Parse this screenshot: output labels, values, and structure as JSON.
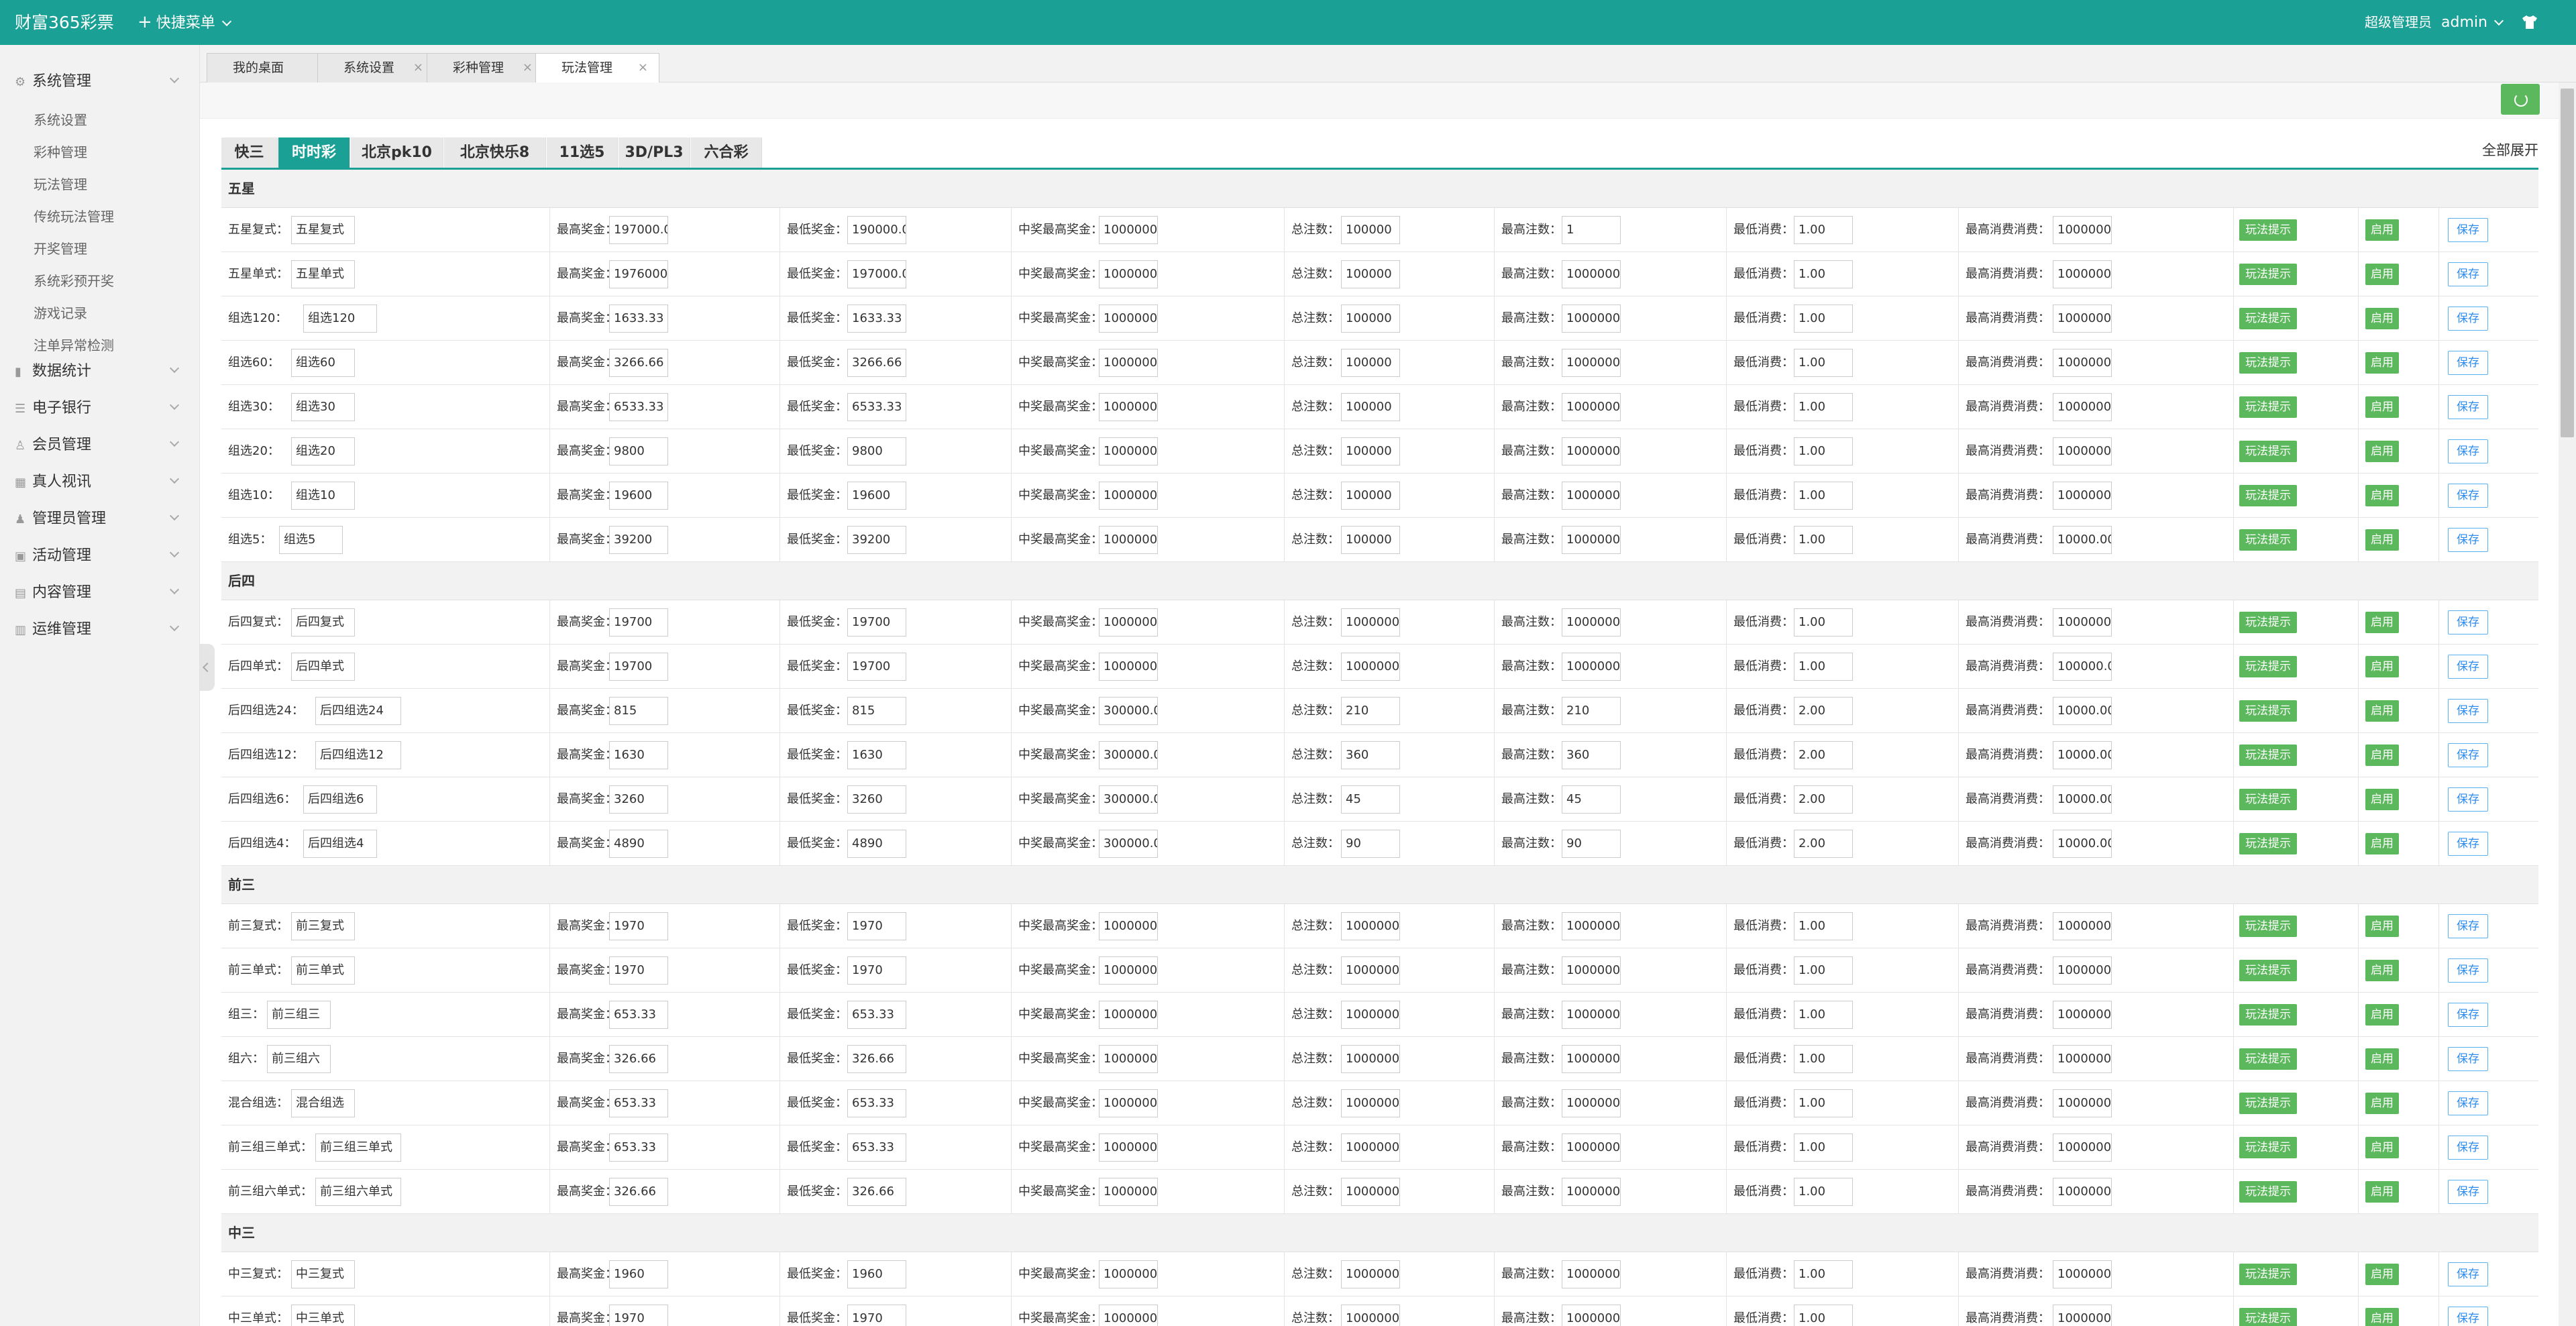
{
  "header": {
    "brand": "财富365彩票",
    "quick_menu": "快捷菜单",
    "role": "超级管理员",
    "user": "admin"
  },
  "sidebar": {
    "groups": [
      {
        "label": "系统管理",
        "icon": "gear-icon",
        "expanded": true,
        "items": [
          "系统设置",
          "彩种管理",
          "玩法管理",
          "传统玩法管理",
          "开奖管理",
          "系统彩预开奖",
          "游戏记录",
          "注单异常检测"
        ]
      },
      {
        "label": "数据统计",
        "icon": "chart-icon"
      },
      {
        "label": "电子银行",
        "icon": "list-icon"
      },
      {
        "label": "会员管理",
        "icon": "user-icon"
      },
      {
        "label": "真人视讯",
        "icon": "video-icon"
      },
      {
        "label": "管理员管理",
        "icon": "admin-icon"
      },
      {
        "label": "活动管理",
        "icon": "activity-icon"
      },
      {
        "label": "内容管理",
        "icon": "content-icon"
      },
      {
        "label": "运维管理",
        "icon": "ops-icon"
      }
    ]
  },
  "page_tabs": [
    "我的桌面",
    "系统设置",
    "彩种管理",
    "玩法管理"
  ],
  "active_page_tab": "玩法管理",
  "game_tabs": [
    "快三",
    "时时彩",
    "北京pk10",
    "北京快乐8",
    "11选5",
    "3D/PL3",
    "六合彩"
  ],
  "active_game_tab": "时时彩",
  "expand_all": "全部展开",
  "field_labels": {
    "max_prize": "最高奖金：",
    "min_prize": "最低奖金：",
    "win_max_prize": "中奖最高奖金：",
    "total_bets": "总注数：",
    "max_bets": "最高注数：",
    "min_cost": "最低消费：",
    "max_cost": "最高消费消费："
  },
  "buttons": {
    "tip": "玩法提示",
    "enable": "启用",
    "save": "保存"
  },
  "sections": [
    {
      "title": "五星",
      "rows": [
        {
          "label": "五星复式：",
          "name": "五星复式",
          "max_prize": "197000.0",
          "min_prize": "190000.0",
          "win_max": "1000000.",
          "total": "100000",
          "max_bets": "1",
          "min_cost": "1.00",
          "max_cost": "1000000."
        },
        {
          "label": "五星单式：",
          "name": "五星单式",
          "max_prize": "1976000",
          "min_prize": "197000.0",
          "win_max": "1000000.",
          "total": "100000",
          "max_bets": "1000000(",
          "min_cost": "1.00",
          "max_cost": "1000000."
        },
        {
          "label": "组选120：",
          "name": "组选120",
          "max_prize": "1633.33",
          "min_prize": "1633.33",
          "win_max": "1000000.",
          "total": "100000",
          "max_bets": "1000000",
          "min_cost": "1.00",
          "max_cost": "1000000."
        },
        {
          "label": "组选60：",
          "name": "组选60",
          "max_prize": "3266.66",
          "min_prize": "3266.66",
          "win_max": "1000000.",
          "total": "100000",
          "max_bets": "1000000",
          "min_cost": "1.00",
          "max_cost": "1000000."
        },
        {
          "label": "组选30：",
          "name": "组选30",
          "max_prize": "6533.33",
          "min_prize": "6533.33",
          "win_max": "1000000.",
          "total": "100000",
          "max_bets": "1000000",
          "min_cost": "1.00",
          "max_cost": "1000000."
        },
        {
          "label": "组选20：",
          "name": "组选20",
          "max_prize": "9800",
          "min_prize": "9800",
          "win_max": "1000000.",
          "total": "100000",
          "max_bets": "1000000",
          "min_cost": "1.00",
          "max_cost": "1000000."
        },
        {
          "label": "组选10：",
          "name": "组选10",
          "max_prize": "19600",
          "min_prize": "19600",
          "win_max": "1000000.",
          "total": "100000",
          "max_bets": "1000000",
          "min_cost": "1.00",
          "max_cost": "1000000."
        },
        {
          "label": "组选5：",
          "name": "组选5",
          "max_prize": "39200",
          "min_prize": "39200",
          "win_max": "1000000.",
          "total": "100000",
          "max_bets": "1000000",
          "min_cost": "1.00",
          "max_cost": "10000.00"
        }
      ]
    },
    {
      "title": "后四",
      "rows": [
        {
          "label": "后四复式：",
          "name": "后四复式",
          "max_prize": "19700",
          "min_prize": "19700",
          "win_max": "1000000.",
          "total": "1000000",
          "max_bets": "1000000",
          "min_cost": "1.00",
          "max_cost": "1000000."
        },
        {
          "label": "后四单式：",
          "name": "后四单式",
          "max_prize": "19700",
          "min_prize": "19700",
          "win_max": "1000000.",
          "total": "1000000",
          "max_bets": "1000000",
          "min_cost": "1.00",
          "max_cost": "100000.0"
        },
        {
          "label": "后四组选24：",
          "name": "后四组选24",
          "max_prize": "815",
          "min_prize": "815",
          "win_max": "300000.0",
          "total": "210",
          "max_bets": "210",
          "min_cost": "2.00",
          "max_cost": "10000.00"
        },
        {
          "label": "后四组选12：",
          "name": "后四组选12",
          "max_prize": "1630",
          "min_prize": "1630",
          "win_max": "300000.0",
          "total": "360",
          "max_bets": "360",
          "min_cost": "2.00",
          "max_cost": "10000.00"
        },
        {
          "label": "后四组选6：",
          "name": "后四组选6",
          "max_prize": "3260",
          "min_prize": "3260",
          "win_max": "300000.0",
          "total": "45",
          "max_bets": "45",
          "min_cost": "2.00",
          "max_cost": "10000.00"
        },
        {
          "label": "后四组选4：",
          "name": "后四组选4",
          "max_prize": "4890",
          "min_prize": "4890",
          "win_max": "300000.0",
          "total": "90",
          "max_bets": "90",
          "min_cost": "2.00",
          "max_cost": "10000.00"
        }
      ]
    },
    {
      "title": "前三",
      "rows": [
        {
          "label": "前三复式：",
          "name": "前三复式",
          "max_prize": "1970",
          "min_prize": "1970",
          "win_max": "1000000.",
          "total": "1000000",
          "max_bets": "1000000",
          "min_cost": "1.00",
          "max_cost": "1000000."
        },
        {
          "label": "前三单式：",
          "name": "前三单式",
          "max_prize": "1970",
          "min_prize": "1970",
          "win_max": "1000000.",
          "total": "1000000",
          "max_bets": "1000000",
          "min_cost": "1.00",
          "max_cost": "1000000."
        },
        {
          "label": "组三：",
          "name": "前三组三",
          "max_prize": "653.33",
          "min_prize": "653.33",
          "win_max": "1000000.",
          "total": "1000000",
          "max_bets": "1000000",
          "min_cost": "1.00",
          "max_cost": "1000000."
        },
        {
          "label": "组六：",
          "name": "前三组六",
          "max_prize": "326.66",
          "min_prize": "326.66",
          "win_max": "1000000.",
          "total": "1000000",
          "max_bets": "1000000",
          "min_cost": "1.00",
          "max_cost": "1000000."
        },
        {
          "label": "混合组选：",
          "name": "混合组选",
          "max_prize": "653.33",
          "min_prize": "653.33",
          "win_max": "1000000.",
          "total": "1000000",
          "max_bets": "1000000",
          "min_cost": "1.00",
          "max_cost": "1000000."
        },
        {
          "label": "前三组三单式：",
          "name": "前三组三单式",
          "max_prize": "653.33",
          "min_prize": "653.33",
          "win_max": "1000000.",
          "total": "1000000",
          "max_bets": "1000000",
          "min_cost": "1.00",
          "max_cost": "1000000."
        },
        {
          "label": "前三组六单式：",
          "name": "前三组六单式",
          "max_prize": "326.66",
          "min_prize": "326.66",
          "win_max": "1000000.",
          "total": "1000000",
          "max_bets": "1000000",
          "min_cost": "1.00",
          "max_cost": "1000000."
        }
      ]
    },
    {
      "title": "中三",
      "rows": [
        {
          "label": "中三复式：",
          "name": "中三复式",
          "max_prize": "1960",
          "min_prize": "1960",
          "win_max": "1000000.",
          "total": "1000000",
          "max_bets": "1000000",
          "min_cost": "1.00",
          "max_cost": "1000000."
        },
        {
          "label": "中三单式：",
          "name": "中三单式",
          "max_prize": "1970",
          "min_prize": "1970",
          "win_max": "1000000.",
          "total": "1000000",
          "max_bets": "1000000",
          "min_cost": "1.00",
          "max_cost": "1000000."
        }
      ]
    }
  ]
}
